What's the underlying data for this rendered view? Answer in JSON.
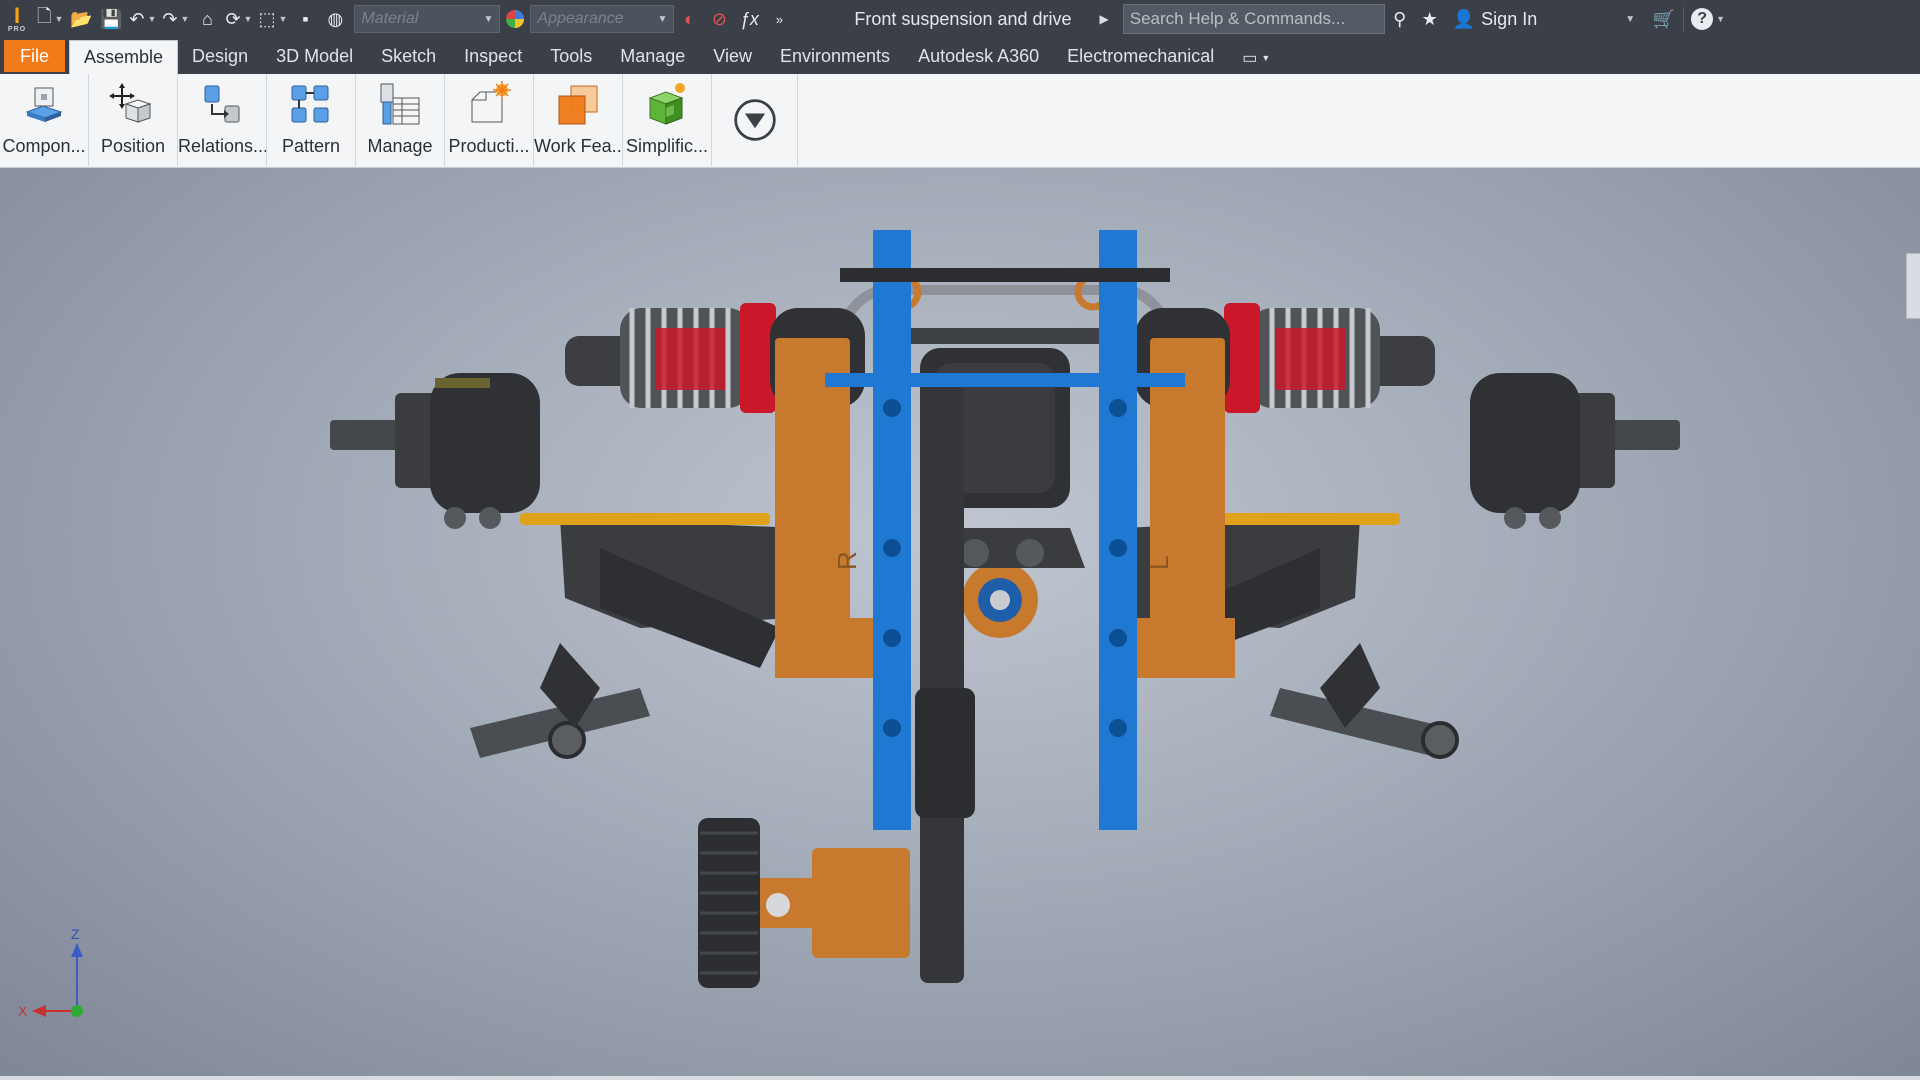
{
  "app": {
    "logo_letter": "I",
    "logo_sub": "PRO"
  },
  "qat": {
    "material_placeholder": "Material",
    "appearance_placeholder": "Appearance",
    "document_title": "Front suspension and drive",
    "search_placeholder": "Search Help & Commands...",
    "sign_in_label": "Sign In"
  },
  "tabs": [
    {
      "label": "File"
    },
    {
      "label": "Assemble"
    },
    {
      "label": "Design"
    },
    {
      "label": "3D Model"
    },
    {
      "label": "Sketch"
    },
    {
      "label": "Inspect"
    },
    {
      "label": "Tools"
    },
    {
      "label": "Manage"
    },
    {
      "label": "View"
    },
    {
      "label": "Environments"
    },
    {
      "label": "Autodesk A360"
    },
    {
      "label": "Electromechanical"
    }
  ],
  "ribbon": {
    "buttons": [
      {
        "label": "Compon...",
        "icon": "component-icon"
      },
      {
        "label": "Position",
        "icon": "position-icon"
      },
      {
        "label": "Relations...",
        "icon": "relationships-icon"
      },
      {
        "label": "Pattern",
        "icon": "pattern-icon"
      },
      {
        "label": "Manage",
        "icon": "manage-icon"
      },
      {
        "label": "Producti...",
        "icon": "productivity-icon"
      },
      {
        "label": "Work Fea...",
        "icon": "work-features-icon"
      },
      {
        "label": "Simplific...",
        "icon": "simplification-icon"
      }
    ]
  },
  "viewport": {
    "axis_labels": {
      "z": "Z",
      "x": "X"
    },
    "part_marks": {
      "right": "R",
      "left": "L"
    }
  },
  "colors": {
    "accent": "#f07b18",
    "blue_part": "#1f78d1",
    "orange_part": "#c77a2e",
    "dark_part": "#3a3c40",
    "shock_red": "#c8182a",
    "rod_yellow": "#e0a21a"
  }
}
